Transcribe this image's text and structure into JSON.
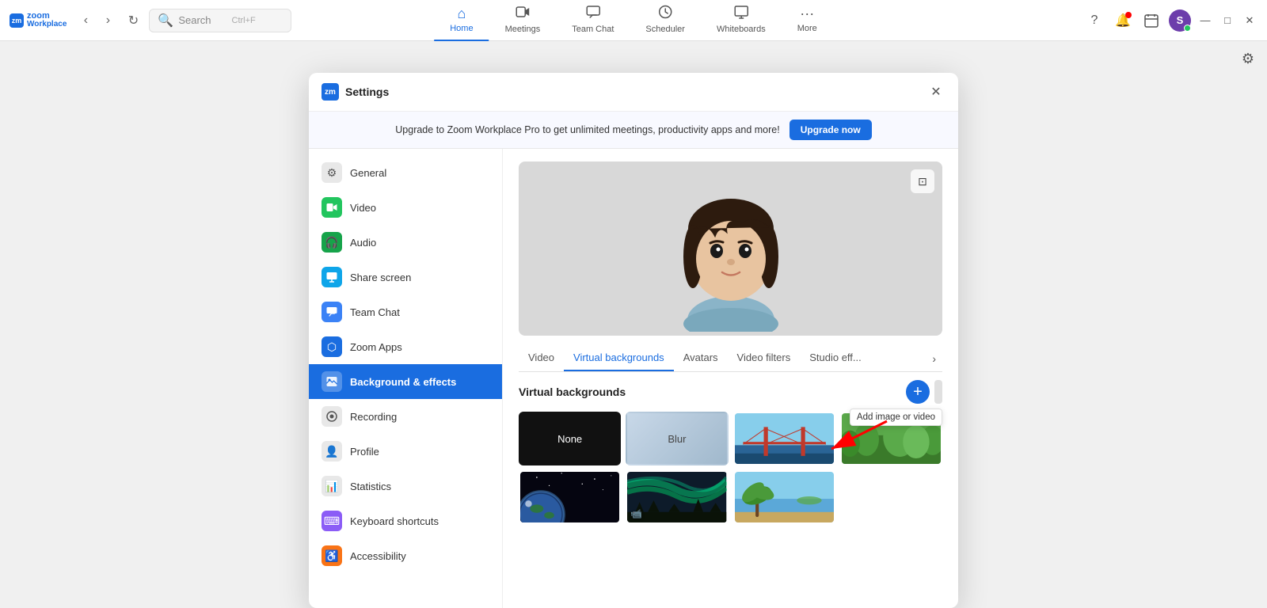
{
  "app": {
    "name": "Zoom Workplace",
    "logo_text": "zoom",
    "logo_sub": "Workplace"
  },
  "topbar": {
    "search_placeholder": "Search",
    "search_shortcut": "Ctrl+F",
    "nav_tabs": [
      {
        "id": "home",
        "label": "Home",
        "icon": "⌂",
        "active": true
      },
      {
        "id": "meetings",
        "label": "Meetings",
        "icon": "📹"
      },
      {
        "id": "team-chat",
        "label": "Team Chat",
        "icon": "💬"
      },
      {
        "id": "scheduler",
        "label": "Scheduler",
        "icon": "🕐"
      },
      {
        "id": "whiteboards",
        "label": "Whiteboards",
        "icon": "⬜"
      },
      {
        "id": "more",
        "label": "More",
        "icon": "···"
      }
    ],
    "avatar_initial": "S",
    "minimize": "—",
    "maximize": "□",
    "close": "✕"
  },
  "settings": {
    "modal_title": "Settings",
    "close_label": "✕",
    "upgrade_text": "Upgrade to Zoom Workplace Pro to get unlimited meetings, productivity apps and more!",
    "upgrade_btn": "Upgrade now",
    "sidebar_items": [
      {
        "id": "general",
        "label": "General",
        "icon": "⚙",
        "icon_style": "gray"
      },
      {
        "id": "video",
        "label": "Video",
        "icon": "📷",
        "icon_style": "green"
      },
      {
        "id": "audio",
        "label": "Audio",
        "icon": "🎧",
        "icon_style": "green2"
      },
      {
        "id": "share-screen",
        "label": "Share screen",
        "icon": "🖥",
        "icon_style": "teal"
      },
      {
        "id": "team-chat",
        "label": "Team Chat",
        "icon": "💬",
        "icon_style": "blue"
      },
      {
        "id": "zoom-apps",
        "label": "Zoom Apps",
        "icon": "⬡",
        "icon_style": "blue2"
      },
      {
        "id": "background-effects",
        "label": "Background & effects",
        "icon": "🎨",
        "icon_style": "blue2",
        "active": true
      },
      {
        "id": "recording",
        "label": "Recording",
        "icon": "⏺",
        "icon_style": "gray"
      },
      {
        "id": "profile",
        "label": "Profile",
        "icon": "👤",
        "icon_style": "gray"
      },
      {
        "id": "statistics",
        "label": "Statistics",
        "icon": "📊",
        "icon_style": "gray"
      },
      {
        "id": "keyboard-shortcuts",
        "label": "Keyboard shortcuts",
        "icon": "⌨",
        "icon_style": "purple"
      },
      {
        "id": "accessibility",
        "label": "Accessibility",
        "icon": "♿",
        "icon_style": "orange"
      }
    ],
    "content": {
      "tabs": [
        {
          "id": "video",
          "label": "Video"
        },
        {
          "id": "virtual-backgrounds",
          "label": "Virtual backgrounds",
          "active": true
        },
        {
          "id": "avatars",
          "label": "Avatars"
        },
        {
          "id": "video-filters",
          "label": "Video filters"
        },
        {
          "id": "studio-effects",
          "label": "Studio eff..."
        }
      ],
      "vb_section_title": "Virtual backgrounds",
      "add_tooltip": "Add image or video",
      "add_btn_icon": "+",
      "backgrounds": [
        {
          "id": "none",
          "label": "None",
          "type": "none"
        },
        {
          "id": "blur",
          "label": "Blur",
          "type": "blur"
        },
        {
          "id": "bridge",
          "label": "",
          "type": "bridge"
        },
        {
          "id": "grass",
          "label": "",
          "type": "grass"
        },
        {
          "id": "space",
          "label": "",
          "type": "space"
        },
        {
          "id": "aurora",
          "label": "",
          "type": "aurora"
        },
        {
          "id": "beach",
          "label": "",
          "type": "beach"
        }
      ]
    }
  }
}
